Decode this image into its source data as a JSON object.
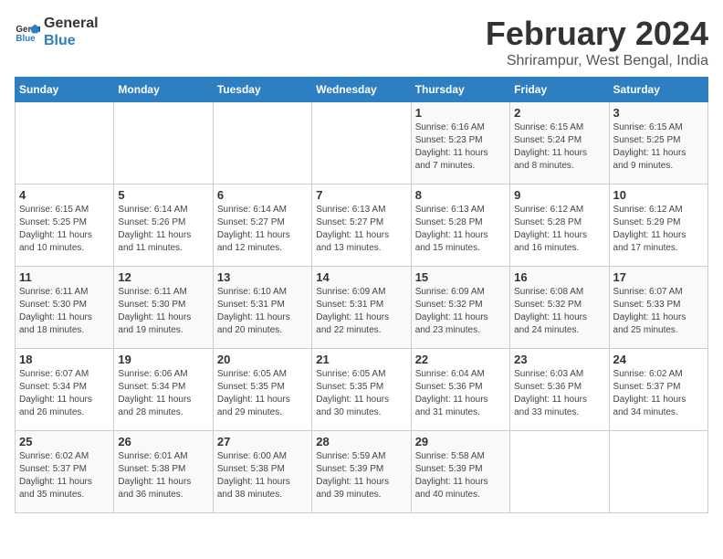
{
  "header": {
    "logo_line1": "General",
    "logo_line2": "Blue",
    "main_title": "February 2024",
    "subtitle": "Shrirampur, West Bengal, India"
  },
  "calendar": {
    "weekdays": [
      "Sunday",
      "Monday",
      "Tuesday",
      "Wednesday",
      "Thursday",
      "Friday",
      "Saturday"
    ],
    "weeks": [
      [
        {
          "day": "",
          "info": ""
        },
        {
          "day": "",
          "info": ""
        },
        {
          "day": "",
          "info": ""
        },
        {
          "day": "",
          "info": ""
        },
        {
          "day": "1",
          "info": "Sunrise: 6:16 AM\nSunset: 5:23 PM\nDaylight: 11 hours\nand 7 minutes."
        },
        {
          "day": "2",
          "info": "Sunrise: 6:15 AM\nSunset: 5:24 PM\nDaylight: 11 hours\nand 8 minutes."
        },
        {
          "day": "3",
          "info": "Sunrise: 6:15 AM\nSunset: 5:25 PM\nDaylight: 11 hours\nand 9 minutes."
        }
      ],
      [
        {
          "day": "4",
          "info": "Sunrise: 6:15 AM\nSunset: 5:25 PM\nDaylight: 11 hours\nand 10 minutes."
        },
        {
          "day": "5",
          "info": "Sunrise: 6:14 AM\nSunset: 5:26 PM\nDaylight: 11 hours\nand 11 minutes."
        },
        {
          "day": "6",
          "info": "Sunrise: 6:14 AM\nSunset: 5:27 PM\nDaylight: 11 hours\nand 12 minutes."
        },
        {
          "day": "7",
          "info": "Sunrise: 6:13 AM\nSunset: 5:27 PM\nDaylight: 11 hours\nand 13 minutes."
        },
        {
          "day": "8",
          "info": "Sunrise: 6:13 AM\nSunset: 5:28 PM\nDaylight: 11 hours\nand 15 minutes."
        },
        {
          "day": "9",
          "info": "Sunrise: 6:12 AM\nSunset: 5:28 PM\nDaylight: 11 hours\nand 16 minutes."
        },
        {
          "day": "10",
          "info": "Sunrise: 6:12 AM\nSunset: 5:29 PM\nDaylight: 11 hours\nand 17 minutes."
        }
      ],
      [
        {
          "day": "11",
          "info": "Sunrise: 6:11 AM\nSunset: 5:30 PM\nDaylight: 11 hours\nand 18 minutes."
        },
        {
          "day": "12",
          "info": "Sunrise: 6:11 AM\nSunset: 5:30 PM\nDaylight: 11 hours\nand 19 minutes."
        },
        {
          "day": "13",
          "info": "Sunrise: 6:10 AM\nSunset: 5:31 PM\nDaylight: 11 hours\nand 20 minutes."
        },
        {
          "day": "14",
          "info": "Sunrise: 6:09 AM\nSunset: 5:31 PM\nDaylight: 11 hours\nand 22 minutes."
        },
        {
          "day": "15",
          "info": "Sunrise: 6:09 AM\nSunset: 5:32 PM\nDaylight: 11 hours\nand 23 minutes."
        },
        {
          "day": "16",
          "info": "Sunrise: 6:08 AM\nSunset: 5:32 PM\nDaylight: 11 hours\nand 24 minutes."
        },
        {
          "day": "17",
          "info": "Sunrise: 6:07 AM\nSunset: 5:33 PM\nDaylight: 11 hours\nand 25 minutes."
        }
      ],
      [
        {
          "day": "18",
          "info": "Sunrise: 6:07 AM\nSunset: 5:34 PM\nDaylight: 11 hours\nand 26 minutes."
        },
        {
          "day": "19",
          "info": "Sunrise: 6:06 AM\nSunset: 5:34 PM\nDaylight: 11 hours\nand 28 minutes."
        },
        {
          "day": "20",
          "info": "Sunrise: 6:05 AM\nSunset: 5:35 PM\nDaylight: 11 hours\nand 29 minutes."
        },
        {
          "day": "21",
          "info": "Sunrise: 6:05 AM\nSunset: 5:35 PM\nDaylight: 11 hours\nand 30 minutes."
        },
        {
          "day": "22",
          "info": "Sunrise: 6:04 AM\nSunset: 5:36 PM\nDaylight: 11 hours\nand 31 minutes."
        },
        {
          "day": "23",
          "info": "Sunrise: 6:03 AM\nSunset: 5:36 PM\nDaylight: 11 hours\nand 33 minutes."
        },
        {
          "day": "24",
          "info": "Sunrise: 6:02 AM\nSunset: 5:37 PM\nDaylight: 11 hours\nand 34 minutes."
        }
      ],
      [
        {
          "day": "25",
          "info": "Sunrise: 6:02 AM\nSunset: 5:37 PM\nDaylight: 11 hours\nand 35 minutes."
        },
        {
          "day": "26",
          "info": "Sunrise: 6:01 AM\nSunset: 5:38 PM\nDaylight: 11 hours\nand 36 minutes."
        },
        {
          "day": "27",
          "info": "Sunrise: 6:00 AM\nSunset: 5:38 PM\nDaylight: 11 hours\nand 38 minutes."
        },
        {
          "day": "28",
          "info": "Sunrise: 5:59 AM\nSunset: 5:39 PM\nDaylight: 11 hours\nand 39 minutes."
        },
        {
          "day": "29",
          "info": "Sunrise: 5:58 AM\nSunset: 5:39 PM\nDaylight: 11 hours\nand 40 minutes."
        },
        {
          "day": "",
          "info": ""
        },
        {
          "day": "",
          "info": ""
        }
      ]
    ]
  }
}
